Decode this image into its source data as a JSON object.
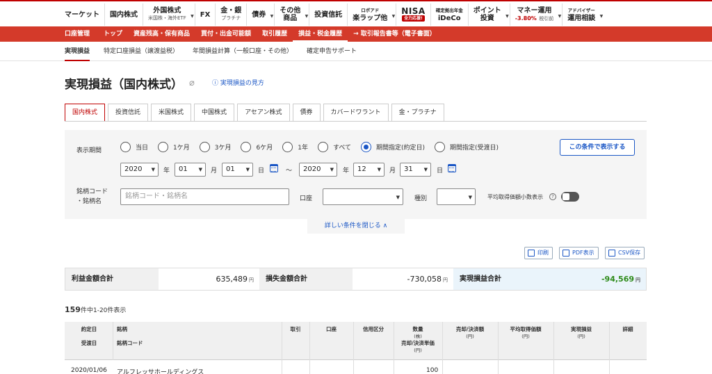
{
  "global_nav": {
    "items": [
      {
        "label": "マーケット"
      },
      {
        "label": "国内株式"
      },
      {
        "label": "外国株式",
        "sub": "米国株・海外ETF",
        "caret": true
      },
      {
        "label": "FX"
      },
      {
        "label": "金・銀",
        "sub": "プラチナ"
      },
      {
        "label": "債券",
        "caret": true
      },
      {
        "label": "その他",
        "sub": "商品",
        "caret": true
      },
      {
        "label": "投資信託"
      },
      {
        "label": "ロボアド",
        "sub": "楽ラップ他",
        "caret": true
      },
      {
        "label": "NISA",
        "badge": "全力応援!"
      },
      {
        "label": "確定拠出年金",
        "sub": "iDeCo"
      },
      {
        "label": "ポイント",
        "sub": "投資",
        "caret": true
      },
      {
        "label": "マネー運用",
        "sub": "-3.80%",
        "sub2": "税引前",
        "caret": true
      },
      {
        "label": "アドバイザー",
        "sub": "運用相談",
        "caret": true
      }
    ]
  },
  "account_nav": {
    "items": [
      "口座管理",
      "トップ",
      "資産残高・保有商品",
      "買付・出金可能額",
      "取引履歴",
      "損益・税金履歴",
      "→ 取引報告書等（電子書面）"
    ],
    "active": "損益・税金履歴"
  },
  "sub_nav": {
    "items": [
      "実現損益",
      "特定口座損益（譲渡益税）",
      "年間損益計算（一般口座・その他）",
      "確定申告サポート"
    ],
    "active": "実現損益"
  },
  "page": {
    "title": "実現損益（国内株式）",
    "howto_link": "実現損益の見方"
  },
  "tabs": [
    "国内株式",
    "投資信託",
    "米国株式",
    "中国株式",
    "アセアン株式",
    "債券",
    "カバードワラント",
    "金・プラチナ"
  ],
  "active_tab": "国内株式",
  "filter": {
    "period_label": "表示期間",
    "period_options": [
      "当日",
      "1ケ月",
      "3ケ月",
      "6ケ月",
      "1年",
      "すべて",
      "期間指定(約定日)",
      "期間指定(受渡日)"
    ],
    "period_selected": "期間指定(約定日)",
    "show_button": "この条件で表示する",
    "from": {
      "year": "2020",
      "month": "01",
      "day": "01"
    },
    "to": {
      "year": "2020",
      "month": "12",
      "day": "31"
    },
    "unit_year": "年",
    "unit_month": "月",
    "unit_day": "日",
    "tilde": "〜",
    "code_label_1": "銘柄コード",
    "code_label_2": "・銘柄名",
    "code_placeholder": "銘柄コード・銘柄名",
    "account_label": "口座",
    "account_value": "",
    "type_label": "種別",
    "type_value": "",
    "decimal_label": "平均取得価額小数表示",
    "collapse_link": "詳しい条件を閉じる ∧"
  },
  "actions": {
    "print": "印刷",
    "pdf": "PDF表示",
    "csv": "CSV保存"
  },
  "summary": {
    "profit_label": "利益金額合計",
    "profit_value": "635,489",
    "loss_label": "損失金額合計",
    "loss_value": "-730,058",
    "net_label": "実現損益合計",
    "net_value": "-94,569",
    "yen": "円"
  },
  "result_count": {
    "total": "159",
    "text": "件中1-20件表示"
  },
  "table": {
    "headers": {
      "date1": "約定日",
      "date2": "受渡日",
      "name1": "銘柄",
      "name2": "銘柄コード",
      "trade": "取引",
      "account": "口座",
      "credit": "信用区分",
      "qty1": "数量",
      "qty_unit": "(株)",
      "qty2": "売却/決済単価",
      "qty2_unit": "(円)",
      "amount": "売却/決済額",
      "amount_unit": "(円)",
      "avg": "平均取得価額",
      "avg_unit": "(円)",
      "pl": "実現損益",
      "pl_unit": "(円)",
      "detail": "詳細"
    },
    "rows": [
      {
        "date": "2020/01/06",
        "name": "アルフレッサホールディングス",
        "qty": "100"
      }
    ]
  }
}
